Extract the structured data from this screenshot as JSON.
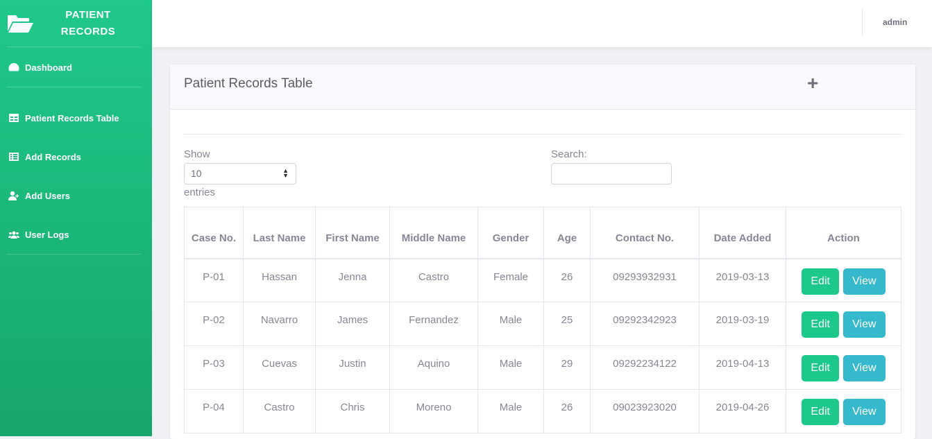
{
  "brand": {
    "title_line1": "PATIENT",
    "title_line2": "RECORDS"
  },
  "sidebar": {
    "items": [
      {
        "label": "Dashboard",
        "icon": "tachometer-icon"
      },
      {
        "label": "Patient Records Table",
        "icon": "table-icon"
      },
      {
        "label": "Add Records",
        "icon": "list-icon"
      },
      {
        "label": "Add Users",
        "icon": "user-plus-icon"
      },
      {
        "label": "User Logs",
        "icon": "users-icon"
      }
    ]
  },
  "topbar": {
    "user": "admin"
  },
  "card": {
    "title": "Patient Records Table",
    "add_icon": "+"
  },
  "controls": {
    "show_label": "Show",
    "entries_value": "10",
    "entries_label": "entries",
    "search_label": "Search:",
    "search_value": ""
  },
  "table": {
    "headers": [
      "Case No.",
      "Last Name",
      "First Name",
      "Middle Name",
      "Gender",
      "Age",
      "Contact No.",
      "Date Added",
      "Action"
    ],
    "rows": [
      [
        "P-01",
        "Hassan",
        "Jenna",
        "Castro",
        "Female",
        "26",
        "09293932931",
        "2019-03-13"
      ],
      [
        "P-02",
        "Navarro",
        "James",
        "Fernandez",
        "Male",
        "25",
        "09292342923",
        "2019-03-19"
      ],
      [
        "P-03",
        "Cuevas",
        "Justin",
        "Aquino",
        "Male",
        "29",
        "09292234122",
        "2019-04-13"
      ],
      [
        "P-04",
        "Castro",
        "Chris",
        "Moreno",
        "Male",
        "26",
        "09023923020",
        "2019-04-26"
      ]
    ],
    "edit_label": "Edit",
    "view_label": "View"
  },
  "colors": {
    "sidebar": "#1fc98a",
    "edit": "#1cc88a",
    "view": "#36b9cc"
  }
}
